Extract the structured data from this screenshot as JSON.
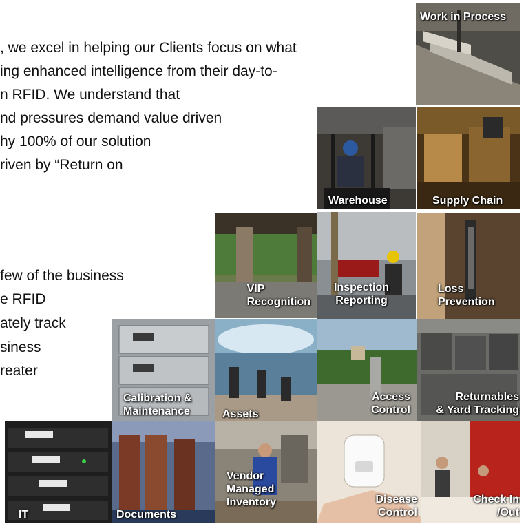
{
  "intro_text": [
    ", we excel in helping our Clients focus on what",
    "ing enhanced intelligence from their day-to-",
    "n RFID. We understand that",
    "nd pressures demand value driven",
    "hy 100% of our solution",
    "riven by “Return on"
  ],
  "business_text": [
    "few of the business",
    "e RFID",
    "ately track",
    "siness",
    "reater"
  ],
  "tiles": {
    "work_in_process": [
      "Work in Process"
    ],
    "warehouse": [
      "Warehouse"
    ],
    "supply_chain": [
      "Supply Chain"
    ],
    "vip_recognition": [
      "VIP",
      "Recognition"
    ],
    "inspection_reporting": [
      "Inspection",
      "Reporting"
    ],
    "loss_prevention": [
      "Loss",
      "Prevention"
    ],
    "calibration_maintenance": [
      "Calibration &",
      "Maintenance"
    ],
    "assets": [
      "Assets"
    ],
    "access_control": [
      "Access",
      "Control"
    ],
    "returnables": [
      "Returnables",
      "& Yard Tracking"
    ],
    "it": [
      "IT"
    ],
    "documents": [
      "Documents"
    ],
    "vendor_managed_inventory": [
      "Vendor",
      "Managed",
      "Inventory"
    ],
    "disease_control": [
      "Disease",
      "Control"
    ],
    "check_in_out": [
      "Check In",
      "/Out"
    ]
  }
}
